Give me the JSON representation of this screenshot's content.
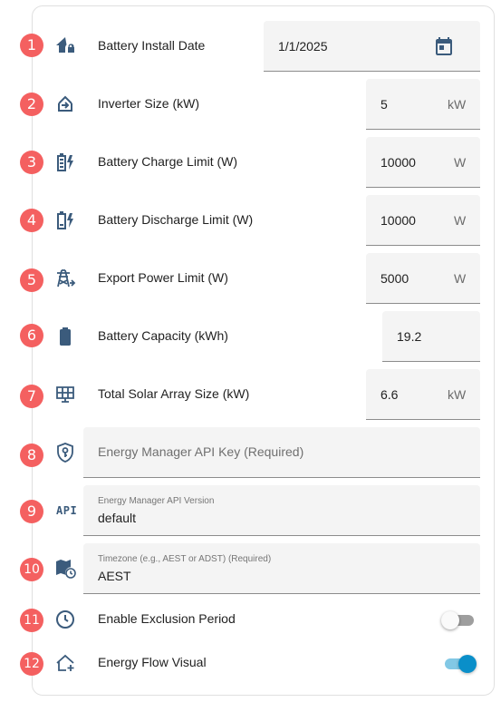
{
  "colors": {
    "badge": "#f46060",
    "icon": "#3b5b7c",
    "accent": "#0a8fc9",
    "field_bg": "#f4f4f4"
  },
  "rows": [
    {
      "badge": "1",
      "icon": "home-lock-icon",
      "label": "Battery Install Date",
      "value": "1/1/2025",
      "suffix_icon": "calendar-icon"
    },
    {
      "badge": "2",
      "icon": "inverter-icon",
      "label": "Inverter Size (kW)",
      "value": "5",
      "suffix": "kW"
    },
    {
      "badge": "3",
      "icon": "battery-charging-icon",
      "label": "Battery Charge Limit (W)",
      "value": "10000",
      "suffix": "W"
    },
    {
      "badge": "4",
      "icon": "battery-discharge-icon",
      "label": "Battery Discharge Limit (W)",
      "value": "10000",
      "suffix": "W"
    },
    {
      "badge": "5",
      "icon": "transmission-tower-export-icon",
      "label": "Export Power Limit (W)",
      "value": "5000",
      "suffix": "W"
    },
    {
      "badge": "6",
      "icon": "battery-icon",
      "label": "Battery Capacity (kWh)",
      "value": "19.2"
    },
    {
      "badge": "7",
      "icon": "solar-panel-icon",
      "label": "Total Solar Array Size (kW)",
      "value": "6.6",
      "suffix": "kW"
    },
    {
      "badge": "8",
      "icon": "shield-key-icon",
      "placeholder": "Energy Manager API Key (Required)"
    },
    {
      "badge": "9",
      "icon_text": "API",
      "field_label": "Energy Manager API Version",
      "value": "default"
    },
    {
      "badge": "10",
      "icon": "map-clock-icon",
      "field_label": "Timezone (e.g., AEST or ADST) (Required)",
      "value": "AEST"
    },
    {
      "badge": "11",
      "icon": "clock-icon",
      "label": "Enable Exclusion Period",
      "toggle": false
    },
    {
      "badge": "12",
      "icon": "home-plus-icon",
      "label": "Energy Flow Visual",
      "toggle": true
    }
  ]
}
